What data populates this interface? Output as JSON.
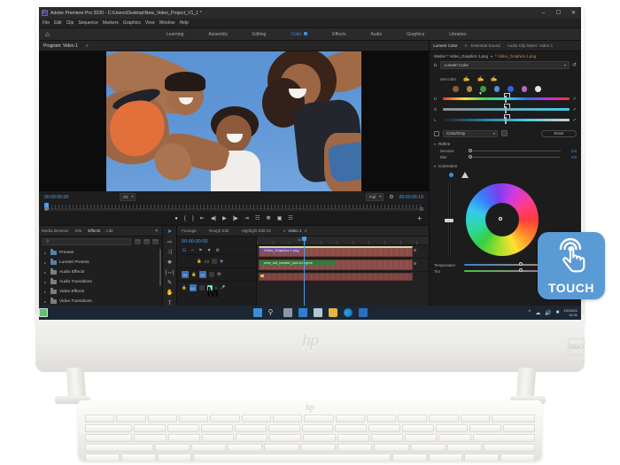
{
  "device": {
    "brand_logo": "hp",
    "audio_logo": "B&O",
    "keyboard_logo": "hp"
  },
  "touch_badge": {
    "label": "TOUCH",
    "icon": "touch-hand-icon",
    "color": "#5b9bd5"
  },
  "app": {
    "title": "Adobe Premiere Pro 2020 - C:\\Users\\Desktop\\New_Video_Project_V1_1 *",
    "icon": "premiere-pro-icon",
    "window_controls": {
      "minimize": "–",
      "maximize": "☐",
      "close": "✕"
    },
    "menu": [
      "File",
      "Edit",
      "Clip",
      "Sequence",
      "Markers",
      "Graphics",
      "View",
      "Window",
      "Help"
    ],
    "home_icon": "home-icon",
    "workspaces": [
      {
        "label": "Learning",
        "active": false
      },
      {
        "label": "Assembly",
        "active": false
      },
      {
        "label": "Editing",
        "active": false
      },
      {
        "label": "Color",
        "active": true
      },
      {
        "label": "Effects",
        "active": false
      },
      {
        "label": "Audio",
        "active": false
      },
      {
        "label": "Graphics",
        "active": false
      },
      {
        "label": "Libraries",
        "active": false
      }
    ]
  },
  "program_monitor": {
    "tab": "Program: Video 1",
    "tab_menu": "≡",
    "playhead_timecode": "00:00:00:00",
    "duration_timecode": "00:00:05:19",
    "fit_select": "Fit",
    "quality_select": "Full",
    "wrench_icon": "settings-wrench-icon",
    "transport": [
      "add-marker-icon",
      "mark-in-icon",
      "mark-out-icon",
      "go-to-in-icon",
      "step-back-icon",
      "play-icon",
      "step-forward-icon",
      "go-to-out-icon",
      "lift-icon",
      "extract-icon",
      "export-frame-icon",
      "comparison-view-icon"
    ],
    "button_editor_icon": "plus-icon"
  },
  "effects_panel": {
    "tabs": [
      {
        "label": "Media Browser",
        "active": false
      },
      {
        "label": "Info",
        "active": false
      },
      {
        "label": "Effects",
        "active": true
      },
      {
        "label": "Libr",
        "active": false
      }
    ],
    "close_icon": "close-icon",
    "search_placeholder": "",
    "search_icon": "search-icon",
    "bin_icons": [
      "accelerated-effects-icon",
      "32-bit-color-icon",
      "ycbcr-icon"
    ],
    "tree": [
      "Presets",
      "Lumetri Presets",
      "Audio Effects",
      "Audio Transitions",
      "Video Effects",
      "Video Transitions"
    ],
    "footer_icons": [
      "new-custom-bin-icon",
      "delete-icon"
    ]
  },
  "tools": [
    "selection-tool-icon",
    "track-select-forward-icon",
    "ripple-edit-icon",
    "razor-tool-icon",
    "slip-tool-icon",
    "pen-tool-icon",
    "hand-tool-icon",
    "type-tool-icon"
  ],
  "timeline": {
    "tabs": [
      {
        "label": "Footage",
        "active": false
      },
      {
        "label": "Rough Edit",
        "active": false
      },
      {
        "label": "Highlight Edit 01",
        "active": false
      },
      {
        "label": "Video 1",
        "active": true
      }
    ],
    "tab_arrow": "▾",
    "tab_menu": "≡",
    "timecode": "00:00:00:00",
    "header_tools": [
      "snap-icon",
      "linked-selection-icon",
      "marker-icon",
      "add-marker-icon",
      "settings-wrench-icon"
    ],
    "ruler_label": "00:00",
    "tracks": [
      {
        "name": "V2",
        "type": "video",
        "lock_icon": "lock-icon",
        "eye_icon": "eye-icon"
      },
      {
        "name": "V1",
        "type": "video",
        "lock_icon": "lock-icon",
        "eye_icon": "eye-icon"
      },
      {
        "name": "A1",
        "type": "audio",
        "mute": "M",
        "solo": "S",
        "mic_icon": "mic-icon"
      }
    ],
    "clips": [
      {
        "name": "Video_Graphics 1.png",
        "label_color": "#6d4d9e",
        "track": "V2"
      },
      {
        "name": "new_ooi_named_pod.srt.pgms",
        "label_color": "#2f7d3c",
        "track": "V1"
      },
      {
        "name": "",
        "label_color": "#d9c84a",
        "track": "A1"
      }
    ],
    "bottom_icons": [
      "settings-gear-icon",
      "zoom-handle-icon"
    ]
  },
  "lumetri": {
    "tabs": [
      {
        "label": "Lumetri Color",
        "active": true
      },
      {
        "label": "Essential Sound",
        "active": false
      },
      {
        "label": "Audio Clip Mixer: Video 1",
        "active": false
      }
    ],
    "tab_menu": "≡",
    "master_label": "Master * Video_Graphics 1.png",
    "clip_label": "* Video_Graphics 1.png",
    "fx_tag": "fx",
    "effect_select": "Lumetri Color",
    "reset_icon": "reset-icon",
    "set_color": {
      "label": "Set color",
      "eyedroppers": [
        "eyedropper-icon",
        "eyedropper-add-icon",
        "eyedropper-remove-icon"
      ],
      "swatches": [
        "#8c5a3c",
        "#b08a3a",
        "#3a9a3a",
        "#5b8fd0",
        "#2f5fe8",
        "#b569c4",
        "#e4e4e4"
      ]
    },
    "hsl": [
      {
        "label": "H",
        "check_icon": "check-icon"
      },
      {
        "label": "S",
        "check_icon": "check-icon"
      },
      {
        "label": "L",
        "check_icon": "check-icon"
      }
    ],
    "color_gray": {
      "checkbox_checked": false,
      "select": "Color/Gray",
      "invert_icon": "invert-icon"
    },
    "reset_button": "Reset",
    "refine": {
      "title": "Refine",
      "sliders": [
        {
          "label": "Denoise",
          "value": "0.0"
        },
        {
          "label": "Blur",
          "value": "0.0"
        }
      ]
    },
    "correction": {
      "title": "Correction",
      "mode_icons": [
        "dot-mode-icon",
        "triangle-mode-icon"
      ],
      "wheel_icon": "color-wheel",
      "vertical_slider": "luma-slider",
      "sliders": [
        {
          "label": "Temperature",
          "value": ""
        },
        {
          "label": "Tint",
          "value": ""
        }
      ]
    }
  },
  "taskbar": {
    "apps": [
      "windows-start-icon",
      "search-icon",
      "task-view-icon",
      "microsoft-store-icon",
      "mail-icon",
      "file-explorer-icon",
      "edge-icon",
      "blue-app-icon",
      "premiere-app-icon"
    ],
    "tray_icons": [
      "show-hidden-icons-icon",
      "network-icon",
      "volume-icon",
      "battery-icon"
    ],
    "clock_date": "10/10/21",
    "clock_time": "11:31"
  }
}
